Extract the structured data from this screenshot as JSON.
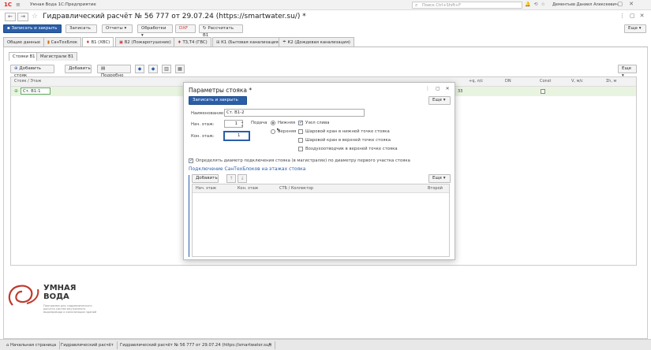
{
  "app": {
    "logo": "1С",
    "title": "Умная Вода 1С:Предприятие",
    "search_placeholder": "Поиск Ctrl+Shift+F",
    "user": "Дементьев Даниил Алексеевич"
  },
  "doc": {
    "title": "Гидравлический расчёт № 56 777 от 29.07.24 (https://smartwater.su/)",
    "modified": "*"
  },
  "toolbar": {
    "save_close": "Записать и закрыть",
    "save": "Записать",
    "reports": "Отчеты",
    "processing": "Обработки",
    "dxf": "DXF",
    "calc": "Рассчитать В1",
    "more": "Еще"
  },
  "tabs": [
    "Общие данные",
    "СанТехБлок",
    "В1 (ХВС)",
    "В2 (Пожаротушение)",
    "Т3,Т4 (ГВС)",
    "К1 (Бытовая канализация)",
    "К2 (Дождевая канализация)"
  ],
  "subtabs": [
    "Стояки В1",
    "Магистрали В1"
  ],
  "grid_toolbar": {
    "add_riser": "Добавить стояк",
    "add": "Добавить",
    "details": "Подробно",
    "more": "Еще"
  },
  "grid": {
    "headers": [
      "Стояк / Этаж",
      "",
      "",
      "",
      "",
      "",
      "+q, л/с",
      "DN",
      "Const",
      "V, м/с",
      "Σh, м"
    ],
    "row": {
      "name": "Ст. В1-1",
      "q": "33"
    }
  },
  "dialog": {
    "title": "Параметры стояка *",
    "save_close": "Записать и закрыть",
    "more": "Еще",
    "name_label": "Наименование:",
    "name_value": "Ст. В1-2",
    "start_floor_label": "Нач. этаж:",
    "start_floor_value": "1",
    "end_floor_label": "Кон. этаж:",
    "end_floor_value": "1",
    "supply_label": "Подача",
    "supply_options": [
      "Нижняя",
      "Верхняя"
    ],
    "checks": [
      {
        "label": "Узел слива",
        "checked": true
      },
      {
        "label": "Шаровой кран в нижней точке стояка",
        "checked": false
      },
      {
        "label": "Шаровой кран в верхней точке стояка",
        "checked": false
      },
      {
        "label": "Воздухоотводчик в верхней точке стояка",
        "checked": false
      }
    ],
    "diam_check": "Определять диаметр подключения стояка (в магистралях) по диаметру первого участка стояка",
    "section_title": "Подключение СанТехБлоков на этажах стояка",
    "add": "Добавить",
    "more2": "Еще",
    "cols": [
      "Нач. этаж",
      "Кон. этаж",
      "СТБ / Коллектор",
      "Второй"
    ]
  },
  "brand": {
    "name_line1": "УМНАЯ",
    "name_line2": "ВОДА",
    "desc": "Программа для гидравлического расчета систем внутреннего водопровода и канализации зданий",
    "accent": "#c0392b"
  },
  "taskbar": [
    "Начальная страница",
    "Гидравлический расчёт",
    "Гидравлический расчёт № 56 777 от 29.07.24 (https://smartwater.su/)"
  ]
}
